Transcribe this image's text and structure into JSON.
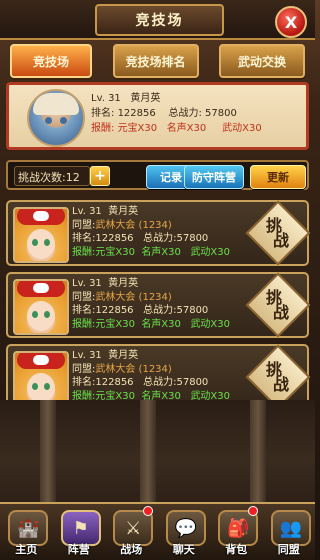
{
  "header": {
    "title": "竞技场",
    "close_label": "X"
  },
  "tabs": [
    {
      "label": "竞技场",
      "active": true
    },
    {
      "label": "竞技场排名",
      "active": false
    },
    {
      "label": "武动交换",
      "active": false
    }
  ],
  "me": {
    "level": "Lv. 31",
    "name": "黄月英",
    "rank_label": "排名:",
    "rank": "122856",
    "power_label": "总战力:",
    "power": "57800",
    "reward_label": "报酬:",
    "reward_yuanbao": "元宝X30",
    "reward_fame": "名声X30",
    "reward_wudong": "武动X30"
  },
  "challenge_bar": {
    "count_label": "挑战次数:12",
    "plus_label": "+",
    "record_label": "记录",
    "defend_label": "防守阵营",
    "refresh_label": "更新"
  },
  "opponents": [
    {
      "level": "Lv. 31",
      "name": "黄月英",
      "guild_label": "同盟:",
      "guild": "武林大会 (1234)",
      "rank_label": "排名:",
      "rank": "122856",
      "power_label": "总战力:",
      "power": "57800",
      "reward_label": "报酬:",
      "reward_yuanbao": "元宝X30",
      "reward_fame": "名声X30",
      "reward_wudong": "武动X30",
      "challenge_label_1": "挑",
      "challenge_label_2": "战"
    },
    {
      "level": "Lv. 31",
      "name": "黄月英",
      "guild_label": "同盟:",
      "guild": "武林大会 (1234)",
      "rank_label": "排名:",
      "rank": "122856",
      "power_label": "总战力:",
      "power": "57800",
      "reward_label": "报酬:",
      "reward_yuanbao": "元宝X30",
      "reward_fame": "名声X30",
      "reward_wudong": "武动X30",
      "challenge_label_1": "挑",
      "challenge_label_2": "战"
    },
    {
      "level": "Lv. 31",
      "name": "黄月英",
      "guild_label": "同盟:",
      "guild": "武林大会 (1234)",
      "rank_label": "排名:",
      "rank": "122856",
      "power_label": "总战力:",
      "power": "57800",
      "reward_label": "报酬:",
      "reward_yuanbao": "元宝X30",
      "reward_fame": "名声X30",
      "reward_wudong": "武动X30",
      "challenge_label_1": "挑",
      "challenge_label_2": "战"
    }
  ],
  "nav": [
    {
      "label": "主页",
      "icon": "castle-icon",
      "active": false,
      "badge": false
    },
    {
      "label": "阵营",
      "icon": "banner-icon",
      "active": true,
      "badge": false
    },
    {
      "label": "战场",
      "icon": "helmet-icon",
      "active": false,
      "badge": true
    },
    {
      "label": "聊天",
      "icon": "chat-icon",
      "active": false,
      "badge": false
    },
    {
      "label": "背包",
      "icon": "bag-icon",
      "active": false,
      "badge": true
    },
    {
      "label": "同盟",
      "icon": "alliance-icon",
      "active": false,
      "badge": false
    }
  ]
}
